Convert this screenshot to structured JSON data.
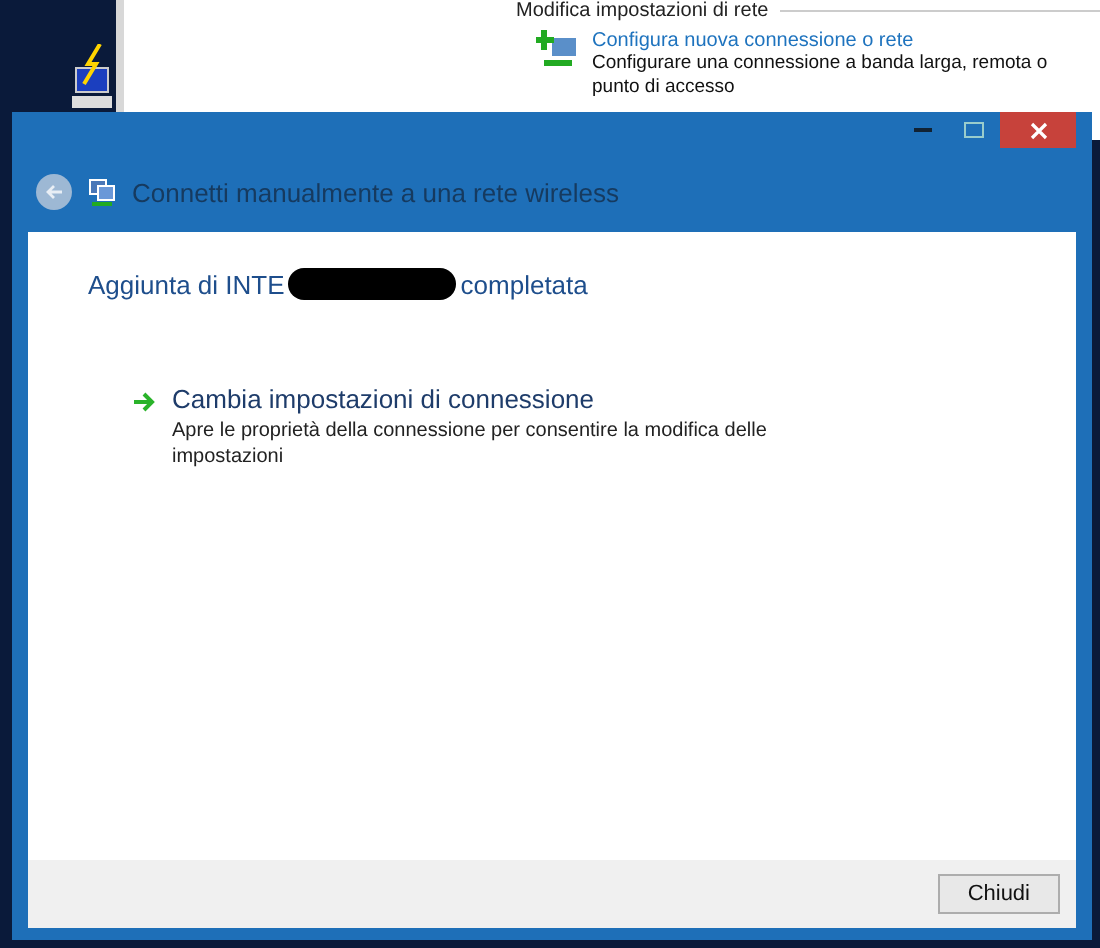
{
  "background_window": {
    "section_title": "Modifica impostazioni di rete",
    "task": {
      "link": "Configura nuova connessione o rete",
      "description": [
        "Configurare una connessione a banda larga, remota o",
        "punto di accesso"
      ]
    }
  },
  "dialog": {
    "window_controls": [
      {
        "kind": "minimize"
      },
      {
        "kind": "maximize"
      },
      {
        "kind": "close"
      }
    ],
    "title": "Connetti manualmente a una rete wireless",
    "heading": {
      "before": "Aggiunta di INTE",
      "after": "completata",
      "redacted": true
    },
    "option": {
      "title": "Cambia impostazioni di connessione",
      "description": "Apre le proprietà della connessione per consentire la modifica delle impostazioni"
    },
    "buttons": [
      "Chiudi"
    ]
  }
}
